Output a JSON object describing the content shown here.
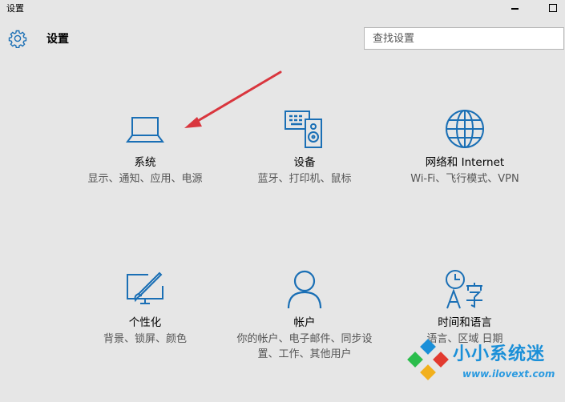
{
  "window": {
    "title": "设置"
  },
  "header": {
    "title": "设置",
    "search_placeholder": "查找设置"
  },
  "tiles": [
    {
      "name": "系统",
      "desc": "显示、通知、应用、电源",
      "icon": "laptop-icon"
    },
    {
      "name": "设备",
      "desc": "蓝牙、打印机、鼠标",
      "icon": "devices-icon"
    },
    {
      "name": "网络和 Internet",
      "desc": "Wi-Fi、飞行模式、VPN",
      "icon": "globe-icon"
    },
    {
      "name": "个性化",
      "desc": "背景、锁屏、颜色",
      "icon": "personalization-icon"
    },
    {
      "name": "帐户",
      "desc": "你的帐户、电子邮件、同步设置、工作、其他用户",
      "icon": "person-icon"
    },
    {
      "name": "时间和语言",
      "desc": "语言、区域 日期",
      "icon": "time-language-icon"
    }
  ],
  "watermark": {
    "brand": "小小系统迷",
    "url": "www.ilovext.com"
  },
  "colors": {
    "accent": "#1a6fb5",
    "background": "#e6e6e6",
    "arrow": "#d9363e"
  }
}
